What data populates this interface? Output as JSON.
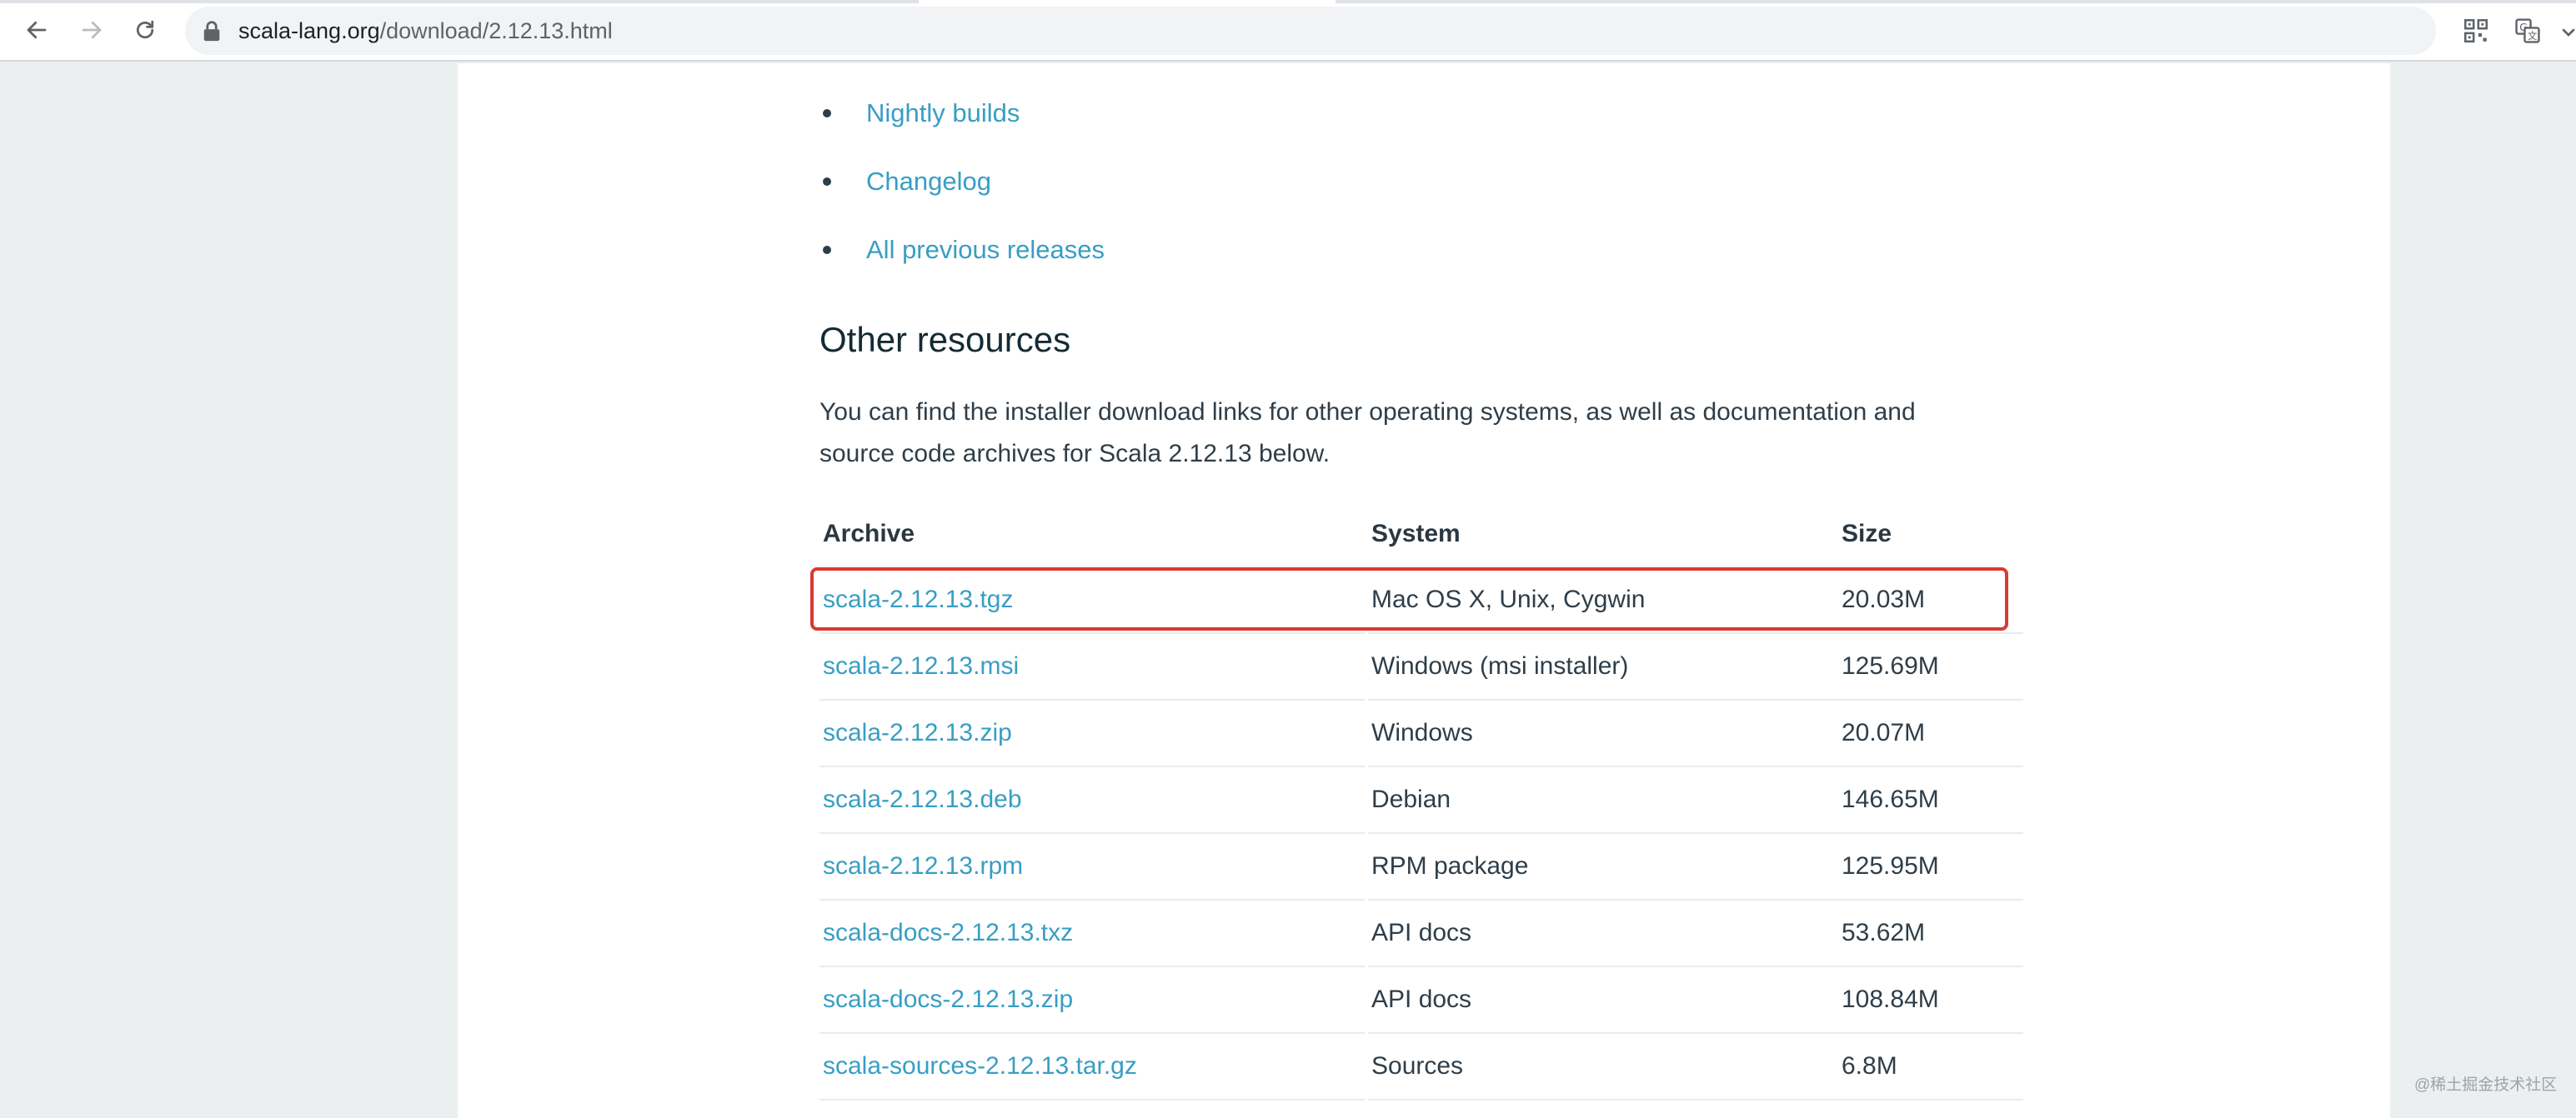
{
  "browser": {
    "url_host": "scala-lang.org",
    "url_path": "/download/2.12.13.html"
  },
  "links": [
    {
      "label": "Nightly builds"
    },
    {
      "label": "Changelog"
    },
    {
      "label": "All previous releases"
    }
  ],
  "other_resources": {
    "title": "Other resources",
    "intro_line1": "You can find the installer download links for other operating systems, as well as documentation and",
    "intro_line2": "source code archives for Scala 2.12.13 below."
  },
  "table": {
    "headers": {
      "archive": "Archive",
      "system": "System",
      "size": "Size"
    },
    "rows": [
      {
        "archive": "scala-2.12.13.tgz",
        "system": "Mac OS X, Unix, Cygwin",
        "size": "20.03M"
      },
      {
        "archive": "scala-2.12.13.msi",
        "system": "Windows (msi installer)",
        "size": "125.69M"
      },
      {
        "archive": "scala-2.12.13.zip",
        "system": "Windows",
        "size": "20.07M"
      },
      {
        "archive": "scala-2.12.13.deb",
        "system": "Debian",
        "size": "146.65M"
      },
      {
        "archive": "scala-2.12.13.rpm",
        "system": "RPM package",
        "size": "125.95M"
      },
      {
        "archive": "scala-docs-2.12.13.txz",
        "system": "API docs",
        "size": "53.62M"
      },
      {
        "archive": "scala-docs-2.12.13.zip",
        "system": "API docs",
        "size": "108.84M"
      },
      {
        "archive": "scala-sources-2.12.13.tar.gz",
        "system": "Sources",
        "size": "6.8M"
      }
    ]
  },
  "watermark": "@稀土掘金技术社区",
  "colors": {
    "link": "#389ec4",
    "highlight": "#d93a32",
    "page_bg": "#ebeff0"
  }
}
